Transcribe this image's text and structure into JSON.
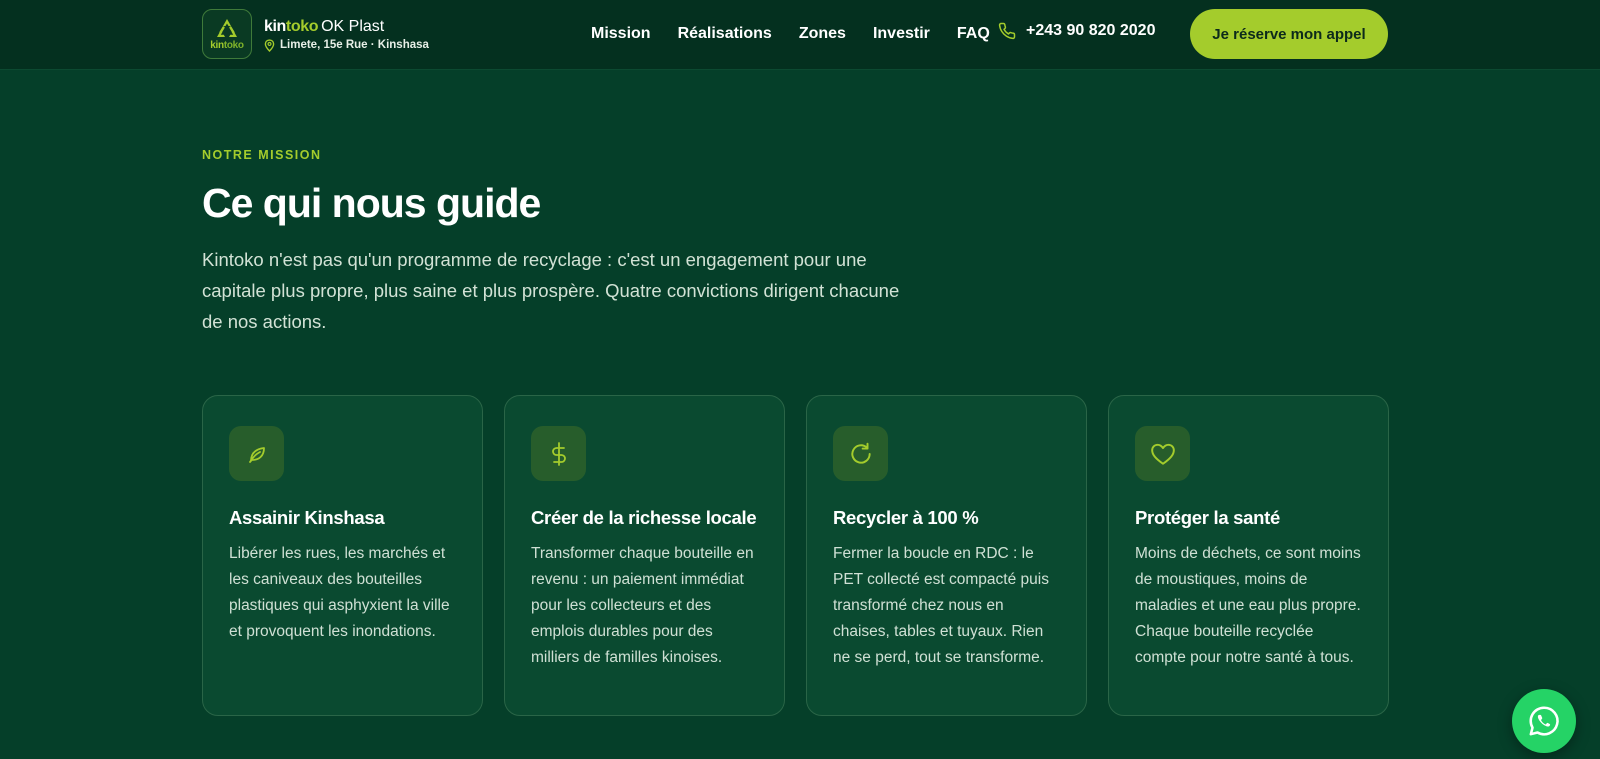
{
  "header": {
    "brand": {
      "logo_word_part1": "kin",
      "logo_word_part2": "toko",
      "name_part1": "kin",
      "name_part2": "toko",
      "name_suffix": "OK Plast",
      "address": "Limete, 15e Rue · Kinshasa"
    },
    "nav": [
      {
        "label": "Mission"
      },
      {
        "label": "Réalisations"
      },
      {
        "label": "Zones"
      },
      {
        "label": "Investir"
      },
      {
        "label": "FAQ"
      }
    ],
    "phone": "+243 90 820 2020",
    "cta_label": "Je réserve mon appel"
  },
  "mission": {
    "eyebrow": "NOTRE MISSION",
    "title": "Ce qui nous guide",
    "intro": "Kintoko n'est pas qu'un programme de recyclage : c'est un engagement pour une capitale plus propre, plus saine et plus prospère. Quatre convictions dirigent chacune de nos actions.",
    "cards": [
      {
        "icon": "leaf-icon",
        "title": "Assainir Kinshasa",
        "text": "Libérer les rues, les marchés et les caniveaux des bouteilles plastiques qui asphyxient la ville et provoquent les inondations."
      },
      {
        "icon": "dollar-icon",
        "title": "Créer de la richesse locale",
        "text": "Transformer chaque bouteille en revenu : un paiement immédiat pour les collecteurs et des emplois durables pour des milliers de familles kinoises."
      },
      {
        "icon": "refresh-icon",
        "title": "Recycler à 100 %",
        "text": "Fermer la boucle en RDC : le PET collecté est compacté puis transformé chez nous en chaises, tables et tuyaux. Rien ne se perd, tout se transforme."
      },
      {
        "icon": "heart-icon",
        "title": "Protéger la santé",
        "text": "Moins de déchets, ce sont moins de moustiques, moins de maladies et une eau plus propre. Chaque bouteille recyclée compte pour notre santé à tous."
      }
    ]
  },
  "colors": {
    "background": "#053f29",
    "header": "#04301f",
    "accent": "#a4cc2c",
    "card": "#0a4a30",
    "whatsapp": "#25d366"
  }
}
